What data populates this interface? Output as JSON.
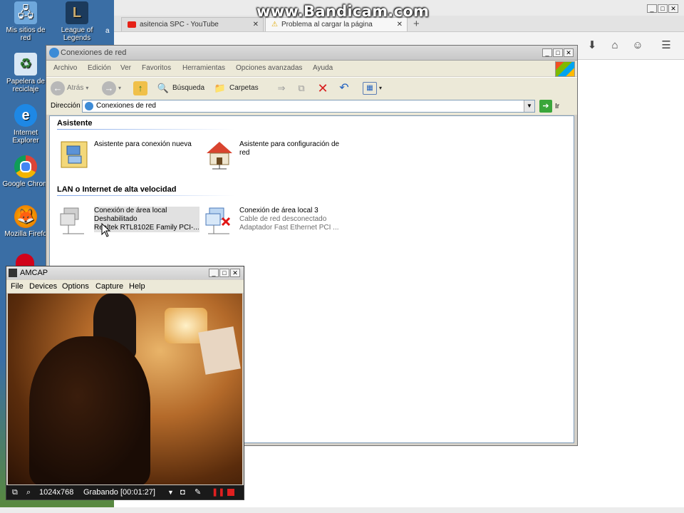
{
  "watermark": "www.Bandicam.com",
  "desktop": {
    "icons": [
      {
        "label": "Mis sitios de red",
        "icon": "network-places-icon"
      },
      {
        "label": "League of Legends",
        "icon": "league-icon"
      },
      {
        "label": "Papelera de reciclaje",
        "icon": "recycle-bin-icon"
      },
      {
        "label": "Internet Explorer",
        "icon": "ie-icon"
      },
      {
        "label": "Google Chrom",
        "icon": "chrome-icon"
      },
      {
        "label": "Mozilla Firefo",
        "icon": "firefox-icon"
      }
    ],
    "partial_label": "a"
  },
  "firefox": {
    "tabs": [
      {
        "label": "asitencia SPC - YouTube"
      },
      {
        "label": "Problema al cargar la página"
      }
    ]
  },
  "netwin": {
    "title": "Conexiones de red",
    "menu": [
      "Archivo",
      "Edición",
      "Ver",
      "Favoritos",
      "Herramientas",
      "Opciones avanzadas",
      "Ayuda"
    ],
    "toolbar": {
      "back": "Atrás",
      "search": "Búsqueda",
      "folders": "Carpetas"
    },
    "address": {
      "label": "Dirección",
      "value": "Conexiones de red",
      "go": "Ir"
    },
    "groups": [
      {
        "title": "Asistente",
        "items": [
          {
            "name": "Asistente para conexión nueva",
            "line2": "",
            "line3": ""
          },
          {
            "name": "Asistente para configuración de red",
            "line2": "",
            "line3": ""
          }
        ]
      },
      {
        "title": "LAN o Internet de alta velocidad",
        "items": [
          {
            "name": "Conexión de área local",
            "line2": "Deshabilitado",
            "line3": "Realtek RTL8102E Family PCI-..."
          },
          {
            "name": "Conexión de área local 3",
            "line2": "Cable de red desconectado",
            "line3": "Adaptador Fast Ethernet PCI ..."
          }
        ]
      }
    ]
  },
  "amcap": {
    "title": "AMCAP",
    "menu": [
      "File",
      "Devices",
      "Options",
      "Capture",
      "Help"
    ],
    "status": {
      "resolution": "1024x768",
      "recording": "Grabando [00:01:27]"
    }
  }
}
